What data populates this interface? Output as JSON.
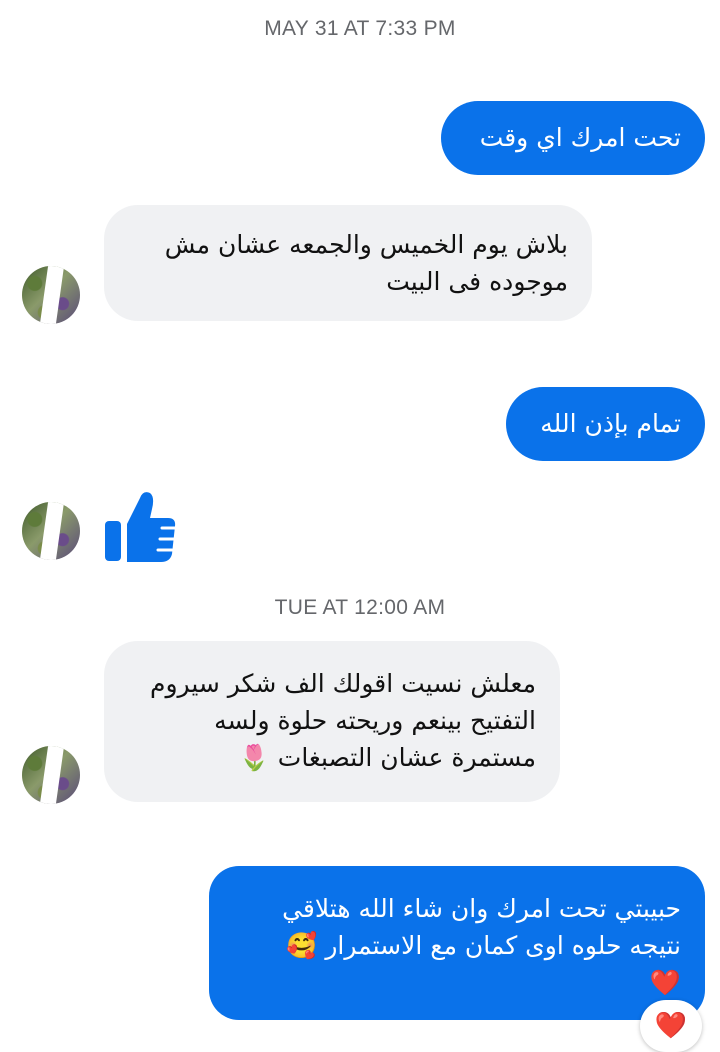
{
  "timestamps": [
    "MAY 31 AT 7:33 PM",
    "TUE AT 12:00 AM"
  ],
  "messages": [
    {
      "from": "me",
      "text": "تحت امرك اي وقت"
    },
    {
      "from": "contact",
      "text": "بلاش يوم الخميس والجمعه عشان مش\nموجوده فى البيت"
    },
    {
      "from": "me",
      "text": "تمام بإذن الله"
    },
    {
      "from": "contact",
      "type": "like",
      "icon": "thumbs-up-icon"
    },
    {
      "from": "contact",
      "text": "معلش نسيت اقولك الف شكر سيروم\nالتفتيح بينعم وريحته حلوة ولسه\nمستمرة عشان التصبغات 🌷"
    },
    {
      "from": "me",
      "text": "حبيبتي تحت امرك وان شاء الله هتلاقي\nنتيجه حلوه اوى كمان مع الاستمرار 🥰\n❤️"
    }
  ],
  "reaction": "❤️",
  "colors": {
    "outgoing": "#0a72ea",
    "incoming": "#f0f1f3",
    "timestamp": "#65676b"
  }
}
